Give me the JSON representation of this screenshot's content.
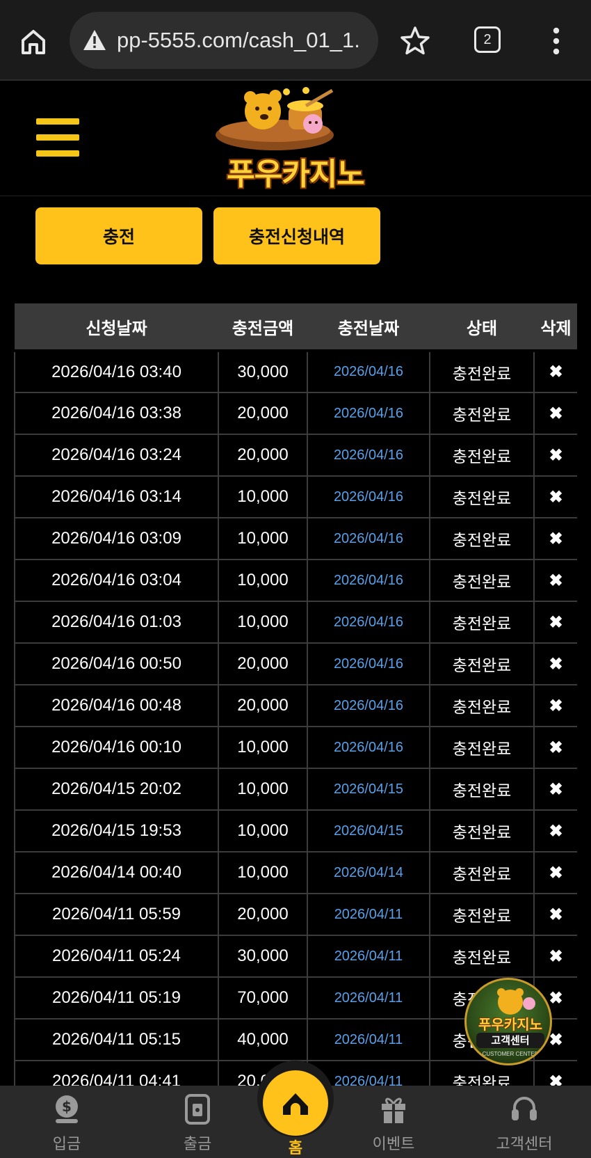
{
  "browser": {
    "url": "pp-5555.com/cash_01_1.",
    "tab_count": "2"
  },
  "site": {
    "logo_text": "푸우카지노"
  },
  "tabs": {
    "charge": "충전",
    "history": "충전신청내역"
  },
  "table": {
    "headers": [
      "신청날짜",
      "충전금액",
      "충전날짜",
      "상태",
      "삭제"
    ],
    "rows": [
      {
        "request_date": "2026/04/16 03:40",
        "amount": "30,000",
        "charge_date": "2026/04/16",
        "status": "충전완료",
        "delete": "✖"
      },
      {
        "request_date": "2026/04/16 03:38",
        "amount": "20,000",
        "charge_date": "2026/04/16",
        "status": "충전완료",
        "delete": "✖"
      },
      {
        "request_date": "2026/04/16 03:24",
        "amount": "20,000",
        "charge_date": "2026/04/16",
        "status": "충전완료",
        "delete": "✖"
      },
      {
        "request_date": "2026/04/16 03:14",
        "amount": "10,000",
        "charge_date": "2026/04/16",
        "status": "충전완료",
        "delete": "✖"
      },
      {
        "request_date": "2026/04/16 03:09",
        "amount": "10,000",
        "charge_date": "2026/04/16",
        "status": "충전완료",
        "delete": "✖"
      },
      {
        "request_date": "2026/04/16 03:04",
        "amount": "10,000",
        "charge_date": "2026/04/16",
        "status": "충전완료",
        "delete": "✖"
      },
      {
        "request_date": "2026/04/16 01:03",
        "amount": "10,000",
        "charge_date": "2026/04/16",
        "status": "충전완료",
        "delete": "✖"
      },
      {
        "request_date": "2026/04/16 00:50",
        "amount": "20,000",
        "charge_date": "2026/04/16",
        "status": "충전완료",
        "delete": "✖"
      },
      {
        "request_date": "2026/04/16 00:48",
        "amount": "20,000",
        "charge_date": "2026/04/16",
        "status": "충전완료",
        "delete": "✖"
      },
      {
        "request_date": "2026/04/16 00:10",
        "amount": "10,000",
        "charge_date": "2026/04/16",
        "status": "충전완료",
        "delete": "✖"
      },
      {
        "request_date": "2026/04/15 20:02",
        "amount": "10,000",
        "charge_date": "2026/04/15",
        "status": "충전완료",
        "delete": "✖"
      },
      {
        "request_date": "2026/04/15 19:53",
        "amount": "10,000",
        "charge_date": "2026/04/15",
        "status": "충전완료",
        "delete": "✖"
      },
      {
        "request_date": "2026/04/14 00:40",
        "amount": "10,000",
        "charge_date": "2026/04/14",
        "status": "충전완료",
        "delete": "✖"
      },
      {
        "request_date": "2026/04/11 05:59",
        "amount": "20,000",
        "charge_date": "2026/04/11",
        "status": "충전완료",
        "delete": "✖"
      },
      {
        "request_date": "2026/04/11 05:24",
        "amount": "30,000",
        "charge_date": "2026/04/11",
        "status": "충전완료",
        "delete": "✖"
      },
      {
        "request_date": "2026/04/11 05:19",
        "amount": "70,000",
        "charge_date": "2026/04/11",
        "status": "충전완료",
        "delete": "✖"
      },
      {
        "request_date": "2026/04/11 05:15",
        "amount": "40,000",
        "charge_date": "2026/04/11",
        "status": "충전완료",
        "delete": "✖"
      },
      {
        "request_date": "2026/04/11 04:41",
        "amount": "20,000",
        "charge_date": "2026/04/11",
        "status": "충전완료",
        "delete": "✖"
      }
    ]
  },
  "cs_badge": {
    "title": "푸우카지노",
    "subtitle": "고객센터",
    "english": "CUSTOMER CENTER"
  },
  "bottom_nav": {
    "deposit": "입금",
    "withdraw": "출금",
    "home": "홈",
    "event": "이벤트",
    "support": "고객센터"
  },
  "colors": {
    "accent": "#ffc21a",
    "charge_date": "#5aa0e8",
    "background": "#000000"
  }
}
